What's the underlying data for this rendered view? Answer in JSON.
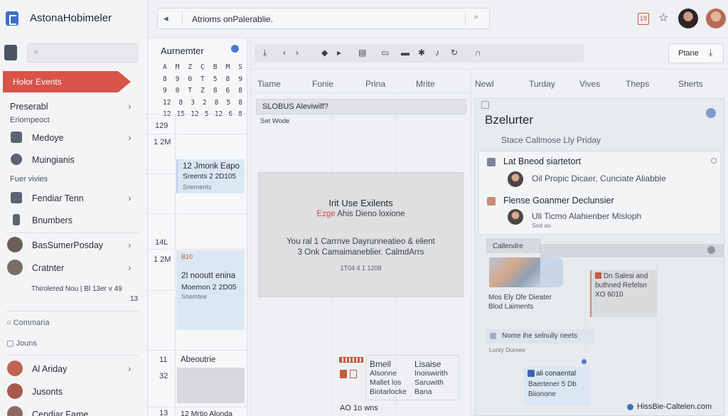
{
  "app": {
    "title": "AstonaHobimeler"
  },
  "search": {
    "placeholder": "Atrioms onPalerablie."
  },
  "sidebar": {
    "active_item": "Holor Events",
    "preserabl": "Preserabl",
    "section1": "Eriompeoct",
    "items1": [
      {
        "label": "Medoye",
        "icon": "folder-icon"
      },
      {
        "label": "Muingianis",
        "icon": "circle-icon"
      }
    ],
    "section2": "Fuer vivies",
    "items2": [
      {
        "label": "Fendiar Tenn",
        "icon": "table-icon"
      },
      {
        "label": "Bnumbers",
        "icon": "book-icon"
      }
    ],
    "items3": [
      {
        "label": "BasSumerPosday",
        "icon": "avatar"
      },
      {
        "label": "Cratnter",
        "icon": "avatar"
      }
    ],
    "footer_line": "Thirolered Nou | Bl  13er v  49",
    "footer_line_num": "13",
    "bottom_links": [
      "Commaria",
      "Jouns"
    ],
    "people": [
      {
        "label": "Al Ariday"
      },
      {
        "label": "Jusonts"
      },
      {
        "label": "Cendiar Fame"
      }
    ]
  },
  "mini_calendar": {
    "title": "Aurnemter",
    "rows": [
      [
        "A",
        "M",
        "Z",
        "C",
        "B",
        "M",
        "S"
      ],
      [
        "8",
        "9",
        "0",
        "T",
        "5",
        "8",
        "9"
      ],
      [
        "9",
        "0",
        "T",
        "Z",
        "8",
        "6",
        "8"
      ],
      [
        "12",
        "8",
        "3",
        "2",
        "8",
        "5",
        "8"
      ],
      [
        "12",
        "15",
        "12",
        "5",
        "12",
        "6",
        "8"
      ]
    ]
  },
  "timeline": {
    "labels": [
      "129",
      "1 2M",
      "14L",
      "1 2M",
      "11",
      "32",
      "13"
    ],
    "events": [
      {
        "title": "12 Jmonk Eapo",
        "line2": "Sreents 2 2D105",
        "line3": "Sriements"
      },
      {
        "title": "2I nooutt enina",
        "line2": "Moemon 2 2D05",
        "line3": "Sriemtee"
      }
    ],
    "bottom_label1": "Abeoutrie",
    "bottom_label2": "12 Mrtio Alonda",
    "side_label": "B10"
  },
  "toolbar": {
    "place_label": "Ptane"
  },
  "columns": [
    "Tiame",
    "Fonie",
    "Prina",
    "Mrite",
    "Newl",
    "Turday",
    "Vives",
    "Theps",
    "Sherts"
  ],
  "banner": {
    "text": "SLOBUS Aleviwilf?",
    "sub": "Set Wode"
  },
  "modal": {
    "title": "Irit Use Exilents",
    "sub_prefix": "Ezge",
    "sub_rest": "Ahis Dieno loxione",
    "p1": "You ral 1 Carrnve Dayrunneatieo & elient",
    "p2": "3 Onk Camaimaneblier. CalmdArrs",
    "footer": "1T04 4 1 1208"
  },
  "mini_cards": [
    {
      "l1": "Bmell",
      "l2": "Alsonne",
      "l3": "Mallet los",
      "l4": "Biotarlocke"
    },
    {
      "l1": "Lisaise",
      "l2": "Inoiswirith",
      "l3": "Saruwith",
      "l4": "Bana"
    }
  ],
  "grid_footer": "AO 1o wns",
  "right_panel": {
    "title": "Bzelurter",
    "subtitle": "Stace Callmose Lly Priday",
    "rows": [
      {
        "title": "Lat Bneod siartetort",
        "sub": "Oil Propic Dicaer, Cunciate Aliabble"
      },
      {
        "title": "Flense Goanmer Declunsier",
        "sub": "Ull Ticmo Alahienber Misloph",
        "sub2": "Sod ao"
      }
    ],
    "tab": "Callendre",
    "photo_caption": [
      "Mos Ely Dfe Dieater",
      "Blod Laiments"
    ],
    "note": "Dn Salesi and buthned Refelsn XO 6010",
    "pill": "Nome ihe selnully neets",
    "pill_sub": "Lonty Durees",
    "event": {
      "title": "ali conaental",
      "l2": "Baertener 5 Db",
      "l3": "Biionone"
    }
  },
  "footer": {
    "brand": "HissBie-Caltelen.com"
  },
  "colors": {
    "accent": "#d9534a",
    "brand": "#3f6fc4",
    "event_bg": "#dbe7f3"
  }
}
